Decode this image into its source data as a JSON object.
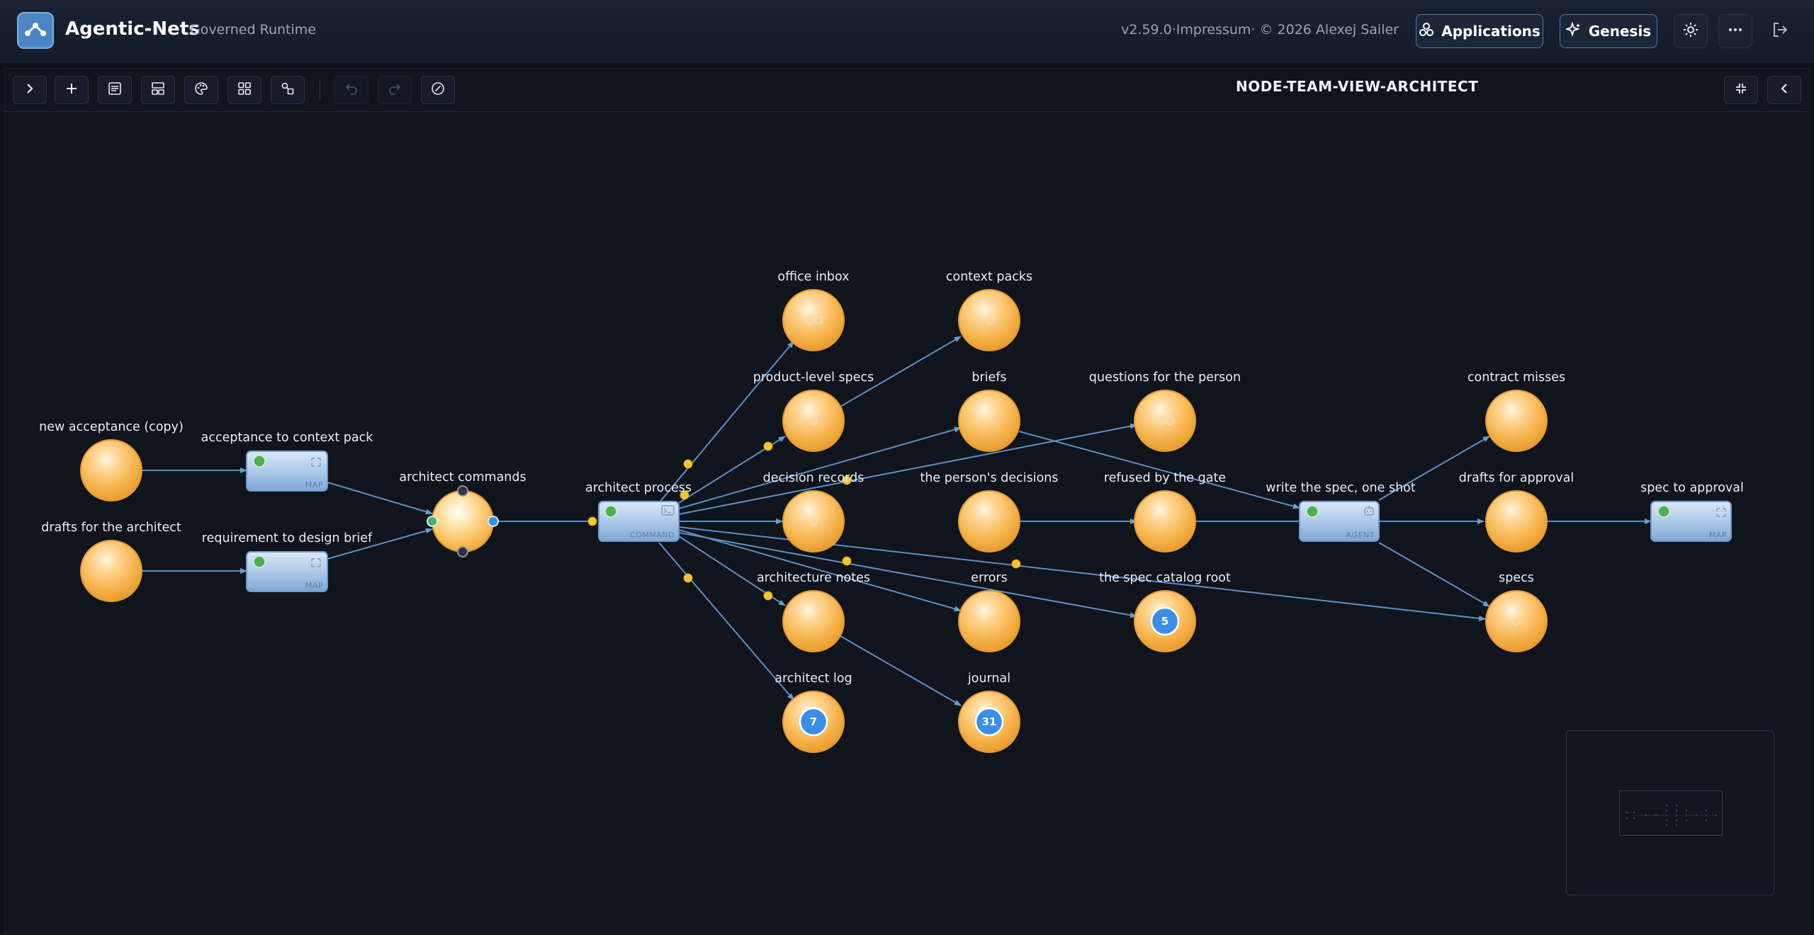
{
  "header": {
    "app_title": "Agentic-Nets",
    "app_subtitle": "Governed Runtime",
    "version_text": "v2.59.0·Impressum· © 2026 Alexej Sailer",
    "applications_label": "Applications",
    "genesis_label": "Genesis",
    "icons": [
      "logo-icon",
      "theme-sun-icon",
      "more-icon",
      "logout-icon"
    ]
  },
  "toolbar": {
    "view_title": "NODE-TEAM-VIEW-ARCHITECT",
    "icons": [
      "expand-sidebar-icon",
      "add-icon",
      "list-icon",
      "layout-icon",
      "palette-icon",
      "grid-icon",
      "shapes-icon",
      "undo-icon",
      "redo-icon",
      "disable-icon",
      "collapse-view-icon",
      "chevron-left-icon"
    ]
  },
  "graph": {
    "places": [
      {
        "id": "new_acceptance",
        "label": "new acceptance (copy)"
      },
      {
        "id": "drafts_architect",
        "label": "drafts for the architect"
      },
      {
        "id": "architect_commands",
        "label": "architect commands"
      },
      {
        "id": "office_inbox",
        "label": "office inbox"
      },
      {
        "id": "product_specs",
        "label": "product-level specs"
      },
      {
        "id": "decision_records",
        "label": "decision records"
      },
      {
        "id": "architecture_notes",
        "label": "architecture notes"
      },
      {
        "id": "architect_log",
        "label": "architect log",
        "tokens": "7"
      },
      {
        "id": "context_packs",
        "label": "context packs"
      },
      {
        "id": "briefs",
        "label": "briefs"
      },
      {
        "id": "persons_decisions",
        "label": "the person's decisions"
      },
      {
        "id": "errors",
        "label": "errors"
      },
      {
        "id": "journal",
        "label": "journal",
        "tokens": "31"
      },
      {
        "id": "questions_person",
        "label": "questions for the person"
      },
      {
        "id": "refused_gate",
        "label": "refused by the gate"
      },
      {
        "id": "spec_catalog_root",
        "label": "the spec catalog root",
        "tokens": "5"
      },
      {
        "id": "contract_misses",
        "label": "contract misses"
      },
      {
        "id": "drafts_approval",
        "label": "drafts for approval"
      },
      {
        "id": "specs",
        "label": "specs"
      }
    ],
    "transitions": [
      {
        "id": "acceptance_to_context",
        "label": "acceptance to context pack",
        "kind": "MAP"
      },
      {
        "id": "requirement_to_brief",
        "label": "requirement to design brief",
        "kind": "MAP"
      },
      {
        "id": "architect_process",
        "label": "architect process",
        "kind": "COMMAND"
      },
      {
        "id": "write_spec",
        "label": "write the spec, one shot",
        "kind": "AGENT"
      },
      {
        "id": "spec_to_approval",
        "label": "spec to approval",
        "kind": "MAP"
      }
    ]
  },
  "colors": {
    "place": "#f6b94f",
    "transition": "#8fb6e0",
    "arc": "#5f8fc3",
    "badge": "#3a8ee6",
    "enabled_dot": "#4caf50",
    "arc_dot": "#f6c532"
  }
}
